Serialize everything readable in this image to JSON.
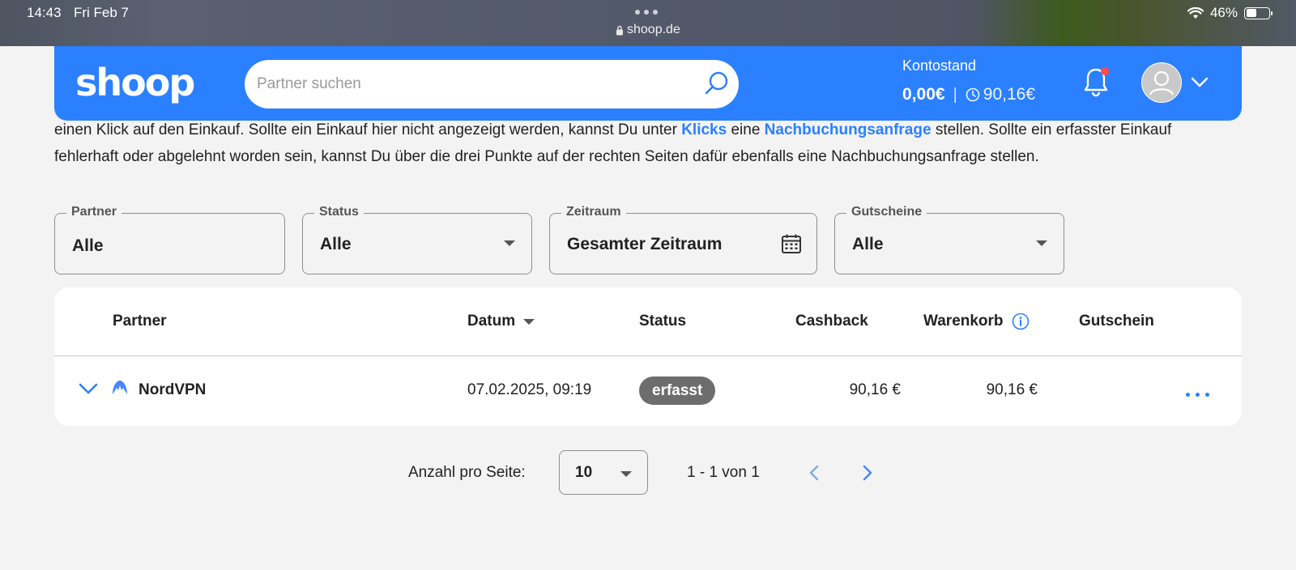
{
  "status_bar": {
    "time": "14:43",
    "date": "Fri Feb 7",
    "url": "shoop.de",
    "battery": "46%",
    "battery_level": 0.46
  },
  "header": {
    "logo": "shoop",
    "search_placeholder": "Partner suchen",
    "konto_label": "Kontostand",
    "konto_amount": "0,00€",
    "konto_separator": "|",
    "konto_pending": "90,16€"
  },
  "description": {
    "line1_a": "einen Klick auf den Einkauf. Sollte ein Einkauf hier nicht angezeigt werden, kannst Du unter ",
    "link_klicks": "Klicks",
    "line1_b": " eine ",
    "link_nachbuchung": "Nachbuchungsanfrage",
    "line1_c": " stellen. Sollte ein erfasster Einkauf",
    "line2": "fehlerhaft oder abgelehnt worden sein, kannst Du über die drei Punkte auf der rechten Seiten dafür ebenfalls eine Nachbuchungsanfrage stellen."
  },
  "filters": {
    "partner": {
      "label": "Partner",
      "value": "Alle"
    },
    "status": {
      "label": "Status",
      "value": "Alle"
    },
    "zeitraum": {
      "label": "Zeitraum",
      "value": "Gesamter Zeitraum"
    },
    "gutscheine": {
      "label": "Gutscheine",
      "value": "Alle"
    }
  },
  "table": {
    "headers": {
      "partner": "Partner",
      "datum": "Datum",
      "status": "Status",
      "cashback": "Cashback",
      "warenkorb": "Warenkorb",
      "gutschein": "Gutschein"
    },
    "rows": [
      {
        "partner": "NordVPN",
        "datum": "07.02.2025, 09:19",
        "status": "erfasst",
        "cashback": "90,16 €",
        "warenkorb": "90,16 €",
        "gutschein": ""
      }
    ]
  },
  "pagination": {
    "label": "Anzahl pro Seite:",
    "per_page": "10",
    "range": "1 - 1 von 1"
  },
  "colors": {
    "brand_blue": "#2a80ff",
    "badge_gray": "#6d6d6d",
    "notification_red": "#ff4a4a"
  }
}
